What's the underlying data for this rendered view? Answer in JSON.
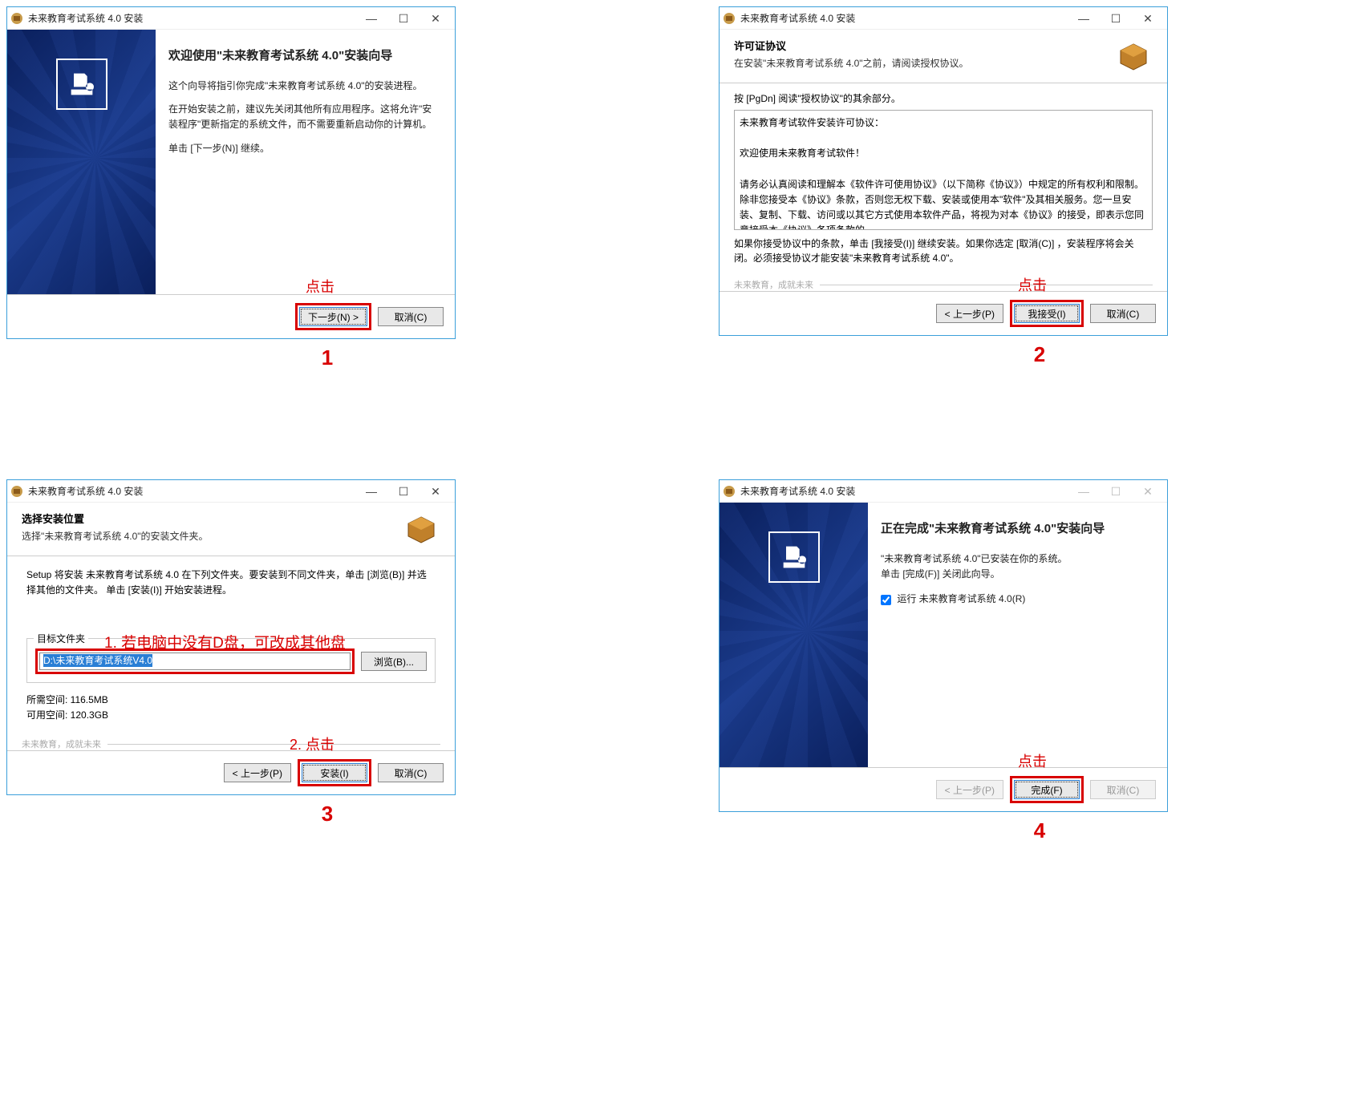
{
  "click_label": "点击",
  "steps": {
    "s1": "1",
    "s2": "2",
    "s3": "3",
    "s4": "4"
  },
  "win_title": "未来教育考试系统 4.0 安装",
  "d1": {
    "heading": "欢迎使用\"未来教育考试系统 4.0\"安装向导",
    "p1": "这个向导将指引你完成\"未来教育考试系统 4.0\"的安装进程。",
    "p2": "在开始安装之前，建议先关闭其他所有应用程序。这将允许\"安装程序\"更新指定的系统文件，而不需要重新启动你的计算机。",
    "p3": "单击 [下一步(N)] 继续。",
    "btn_next": "下一步(N) >",
    "btn_cancel": "取消(C)"
  },
  "d2": {
    "hdr_title": "许可证协议",
    "hdr_sub": "在安装\"未来教育考试系统 4.0\"之前，请阅读授权协议。",
    "pgdn": "按 [PgDn] 阅读\"授权协议\"的其余部分。",
    "lic_l1": "未来教育考试软件安装许可协议：",
    "lic_l2": "欢迎使用未来教育考试软件！",
    "lic_l3": "请务必认真阅读和理解本《软件许可使用协议》（以下简称《协议》）中规定的所有权利和限制。除非您接受本《协议》条款，否则您无权下载、安装或使用本\"软件\"及其相关服务。您一旦安装、复制、下载、访问或以其它方式使用本软件产品，将视为对本《协议》的接受，即表示您同意接受本《协议》各项条款的",
    "note": "如果你接受协议中的条款，单击 [我接受(I)] 继续安装。如果你选定 [取消(C)] ，安装程序将会关闭。必须接受协议才能安装\"未来教育考试系统 4.0\"。",
    "brand": "未来教育，成就未来",
    "btn_back": "< 上一步(P)",
    "btn_accept": "我接受(I)",
    "btn_cancel": "取消(C)"
  },
  "d3": {
    "hdr_title": "选择安装位置",
    "hdr_sub": "选择\"未来教育考试系统 4.0\"的安装文件夹。",
    "instr": "Setup 将安装 未来教育考试系统 4.0 在下列文件夹。要安装到不同文件夹，单击 [浏览(B)] 并选择其他的文件夹。 单击 [安装(I)] 开始安装进程。",
    "fieldset_label": "目标文件夹",
    "red_note": "1. 若电脑中没有D盘，可改成其他盘",
    "path": "D:\\未来教育考试系统V4.0",
    "btn_browse": "浏览(B)...",
    "space1": "所需空间: 116.5MB",
    "space2": "可用空间: 120.3GB",
    "brand": "未来教育，成就未来",
    "click2": "2. 点击",
    "btn_back": "< 上一步(P)",
    "btn_install": "安装(I)",
    "btn_cancel": "取消(C)"
  },
  "d4": {
    "heading": "正在完成\"未来教育考试系统 4.0\"安装向导",
    "p1": "\"未来教育考试系统 4.0\"已安装在你的系统。\n单击 [完成(F)] 关闭此向导。",
    "chk": "运行 未来教育考试系统 4.0(R)",
    "btn_back": "< 上一步(P)",
    "btn_finish": "完成(F)",
    "btn_cancel": "取消(C)"
  }
}
